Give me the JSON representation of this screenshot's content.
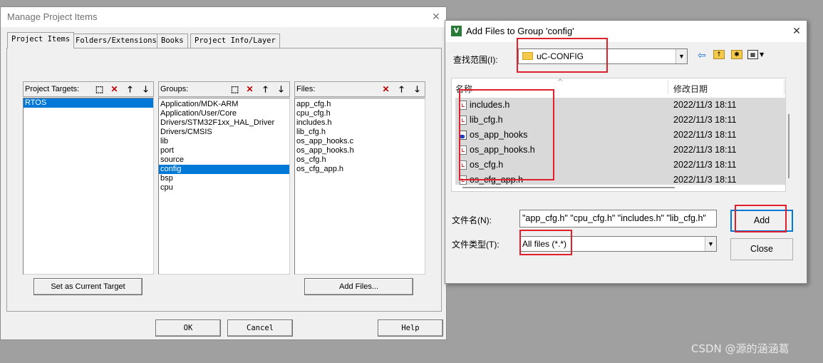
{
  "manage_dialog": {
    "title": "Manage Project Items",
    "close_glyph": "✕",
    "tabs": [
      "Project Items",
      "Folders/Extensions",
      "Books",
      "Project Info/Layer"
    ],
    "targets_label": "Project Targets:",
    "groups_label": "Groups:",
    "files_label": "Files:",
    "targets": [
      "RTOS"
    ],
    "groups": [
      "Application/MDK-ARM",
      "Application/User/Core",
      "Drivers/STM32F1xx_HAL_Driver",
      "Drivers/CMSIS",
      "lib",
      "port",
      "source",
      "config",
      "bsp",
      "cpu"
    ],
    "files": [
      "app_cfg.h",
      "cpu_cfg.h",
      "includes.h",
      "lib_cfg.h",
      "os_app_hooks.c",
      "os_app_hooks.h",
      "os_cfg.h",
      "os_cfg_app.h"
    ],
    "set_target_button": "Set as Current Target",
    "add_files_button": "Add Files...",
    "ok_button": "OK",
    "cancel_button": "Cancel",
    "help_button": "Help",
    "icons": {
      "new": "new-item-icon",
      "delete": "delete-icon",
      "up": "move-up-icon",
      "down": "move-down-icon"
    },
    "selection_color": "#0078d7"
  },
  "add_dialog": {
    "title": "Add Files to Group 'config'",
    "close_glyph": "✕",
    "look_in_label": "查找范围(I):",
    "look_in_value": "uC-CONFIG",
    "col_name": "名称",
    "col_date": "修改日期",
    "rows": [
      {
        "name": "includes.h",
        "date": "2022/11/3 18:11",
        "type": "header"
      },
      {
        "name": "lib_cfg.h",
        "date": "2022/11/3 18:11",
        "type": "header"
      },
      {
        "name": "os_app_hooks",
        "date": "2022/11/3 18:11",
        "type": "exe"
      },
      {
        "name": "os_app_hooks.h",
        "date": "2022/11/3 18:11",
        "type": "header"
      },
      {
        "name": "os_cfg.h",
        "date": "2022/11/3 18:11",
        "type": "header"
      },
      {
        "name": "os_cfg_app.h",
        "date": "2022/11/3 18:11",
        "type": "header"
      }
    ],
    "filename_label": "文件名(N):",
    "filename_value": "\"app_cfg.h\" \"cpu_cfg.h\" \"includes.h\" \"lib_cfg.h\"",
    "filetype_label": "文件类型(T):",
    "filetype_value": "All files (*.*)",
    "add_button": "Add",
    "close_button": "Close",
    "highlight_color": "#e0202a"
  },
  "watermark": "CSDN @源的涵涵葛"
}
